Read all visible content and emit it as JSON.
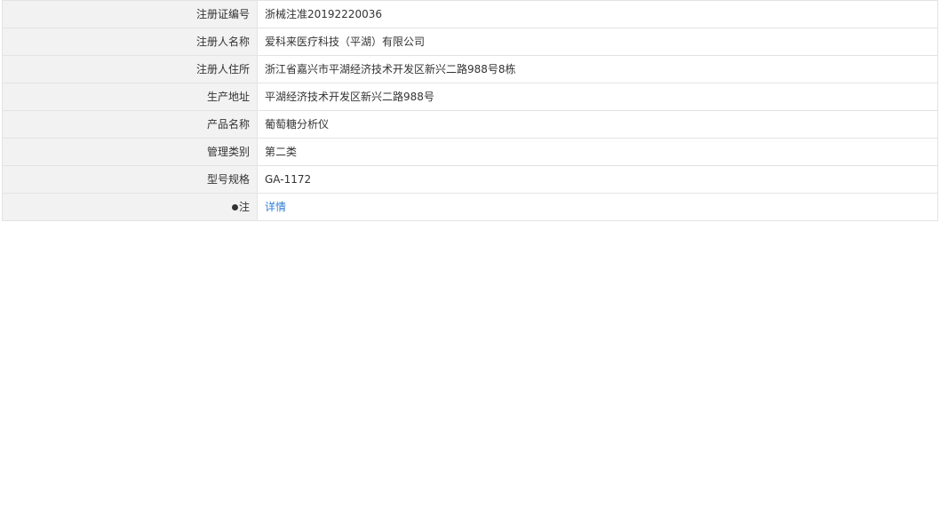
{
  "rows": [
    {
      "label": "注册证编号",
      "value": "浙械注准20192220036"
    },
    {
      "label": "注册人名称",
      "value": "爱科来医疗科技（平湖）有限公司"
    },
    {
      "label": "注册人住所",
      "value": "浙江省嘉兴市平湖经济技术开发区新兴二路988号8栋"
    },
    {
      "label": "生产地址",
      "value": "平湖经济技术开发区新兴二路988号"
    },
    {
      "label": "产品名称",
      "value": "葡萄糖分析仪"
    },
    {
      "label": "管理类别",
      "value": "第二类"
    },
    {
      "label": "型号规格",
      "value": "GA-1172"
    }
  ],
  "footer": {
    "label": "注",
    "link_label": "详情"
  }
}
